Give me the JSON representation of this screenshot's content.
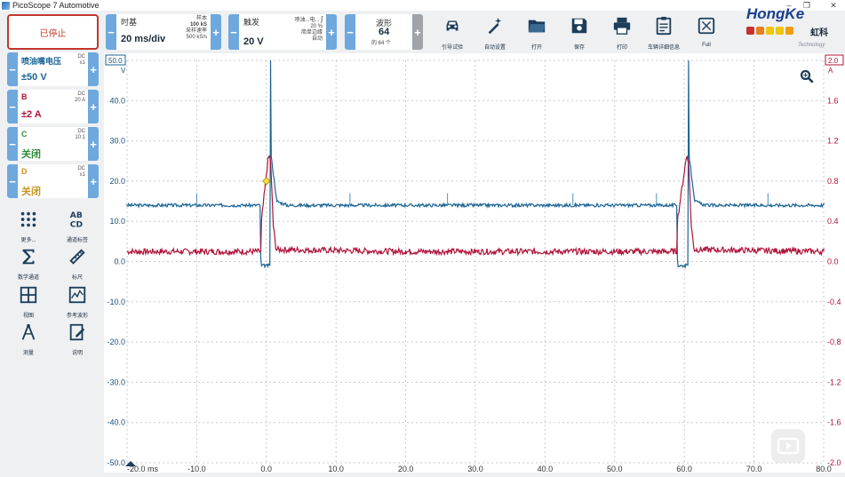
{
  "window": {
    "title": "PicoScope 7 Automotive"
  },
  "toolbar": {
    "stop_label": "已停止",
    "timebase": {
      "label": "时基",
      "value": "20 ms/div",
      "samples_label": "样本",
      "samples_value": "100 kS",
      "rate_label": "采样速率",
      "rate_value": "500 kS/s"
    },
    "trigger": {
      "label": "触发",
      "value": "20 V",
      "source": "喷油...电...",
      "pct": "20 %",
      "mode1": "简单边缘",
      "mode2": "自动",
      "edge_symbol": "ʃ"
    },
    "waveform": {
      "label": "波形",
      "value": "64",
      "of_total": "的 64 个"
    },
    "tools": [
      {
        "icon": "car-icon",
        "label": "引导试验"
      },
      {
        "icon": "wand-icon",
        "label": "自动设置"
      },
      {
        "icon": "folder-icon",
        "label": "打开"
      },
      {
        "icon": "save-icon",
        "label": "保存"
      },
      {
        "icon": "printer-icon",
        "label": "打印"
      },
      {
        "icon": "clipboard-icon",
        "label": "车辆详细信息"
      },
      {
        "icon": "fullscreen-icon",
        "label": "Full"
      }
    ]
  },
  "brand": {
    "name": "HongKe",
    "chinese": "虹科",
    "tagline": "Technology"
  },
  "channels": [
    {
      "name": "喷油嘴电压",
      "coupling": "DC",
      "probe": "x1",
      "range": "±50 V",
      "color": "#1a6496"
    },
    {
      "name": "B",
      "coupling": "DC",
      "probe": "20 A",
      "range": "±2 A",
      "color": "#b0133a"
    },
    {
      "name": "C",
      "coupling": "DC",
      "probe": "10:1",
      "range": "关闭",
      "color": "#2e8b3a"
    },
    {
      "name": "D",
      "coupling": "DC",
      "probe": "x1",
      "range": "关闭",
      "color": "#c8951e"
    }
  ],
  "side_tools": [
    {
      "icon": "more-icon",
      "label": "更多..."
    },
    {
      "icon": "channel-labels-icon",
      "label": "通道标签"
    },
    {
      "icon": "math-icon",
      "label": "数学通道"
    },
    {
      "icon": "ruler-icon",
      "label": "标尺"
    },
    {
      "icon": "views-icon",
      "label": "视图"
    },
    {
      "icon": "reference-waveform-icon",
      "label": "参考波形"
    },
    {
      "icon": "measure-icon",
      "label": "测量"
    },
    {
      "icon": "notes-icon",
      "label": "说明"
    }
  ],
  "chart_data": {
    "type": "line",
    "title": "",
    "xlabel": "ms",
    "xlim": [
      -20,
      80
    ],
    "x_ticks": [
      "-20.0 ms",
      "-10.0",
      "0.0",
      "10.0",
      "20.0",
      "30.0",
      "40.0",
      "50.0",
      "60.0",
      "70.0",
      "80.0"
    ],
    "left_axis": {
      "unit": "V",
      "top_label": "50.0",
      "ylim": [
        -50,
        50
      ],
      "ticks": [
        "40.0",
        "30.0",
        "20.0",
        "10.0",
        "0.0",
        "-10.0",
        "-20.0",
        "-30.0",
        "-40.0",
        "-50.0"
      ]
    },
    "right_axis": {
      "unit": "A",
      "top_label": "2.0",
      "ylim": [
        -2,
        2
      ],
      "ticks": [
        "1.6",
        "1.2",
        "0.8",
        "0.4",
        "0.0",
        "-0.4",
        "-0.8",
        "-1.2",
        "-1.6",
        "-2.0"
      ]
    },
    "grid": true,
    "trigger_marker": {
      "x": 0,
      "y": 20
    },
    "series": [
      {
        "name": "喷油嘴电压",
        "axis": "left",
        "color": "#1a6496",
        "x": [
          -20,
          -0.9,
          -0.8,
          -0.7,
          0.5,
          0.6,
          0.7,
          1.5,
          3,
          6,
          8,
          20,
          58.9,
          59,
          59.1,
          60.5,
          60.6,
          60.7,
          61.5,
          63,
          66,
          80
        ],
        "y": [
          14,
          14,
          0.5,
          -1,
          -1,
          50,
          26,
          15,
          14,
          14,
          14,
          14,
          14,
          0.5,
          -1,
          -1,
          50,
          26,
          15,
          14,
          14,
          14
        ]
      },
      {
        "name": "B",
        "axis": "right",
        "color": "#b0133a",
        "x": [
          -20,
          -0.8,
          -0.7,
          0.2,
          0.4,
          0.6,
          1.0,
          1.4,
          20,
          58.9,
          59.0,
          60.2,
          60.4,
          60.6,
          61.0,
          61.4,
          80
        ],
        "y": [
          0.1,
          0.1,
          0.4,
          1.0,
          1.05,
          1.0,
          0.35,
          0.12,
          0.1,
          0.1,
          0.4,
          1.0,
          1.05,
          1.0,
          0.35,
          0.12,
          0.1
        ]
      }
    ]
  }
}
